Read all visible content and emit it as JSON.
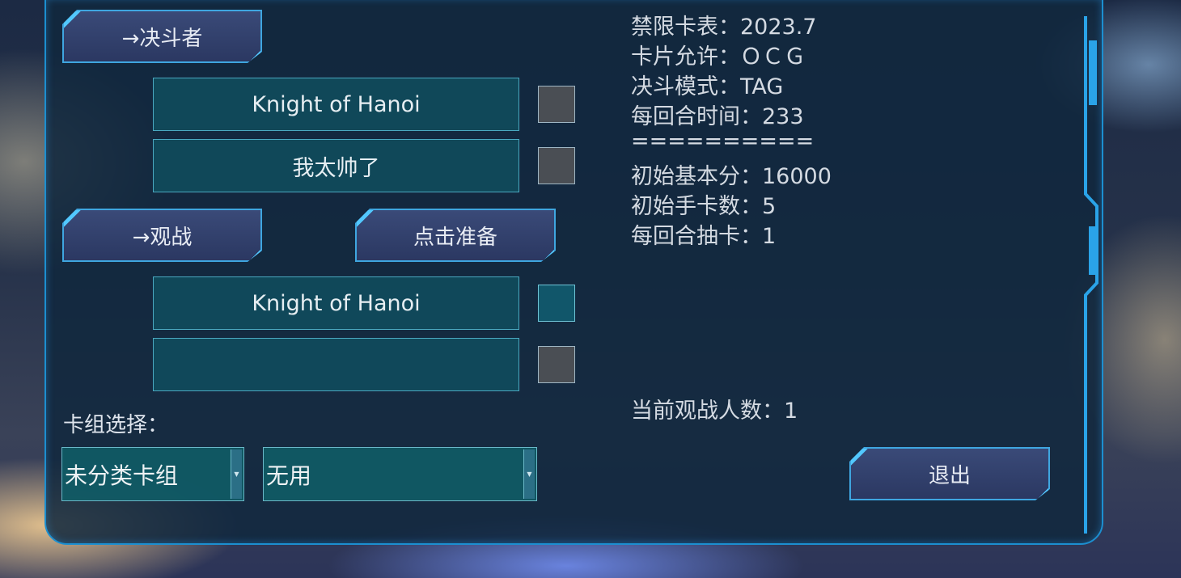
{
  "buttons": {
    "duelist": "→决斗者",
    "spectate": "→观战",
    "ready": "点击准备",
    "exit": "退出"
  },
  "players": [
    {
      "name": "Knight of Hanoi",
      "checked": false
    },
    {
      "name": "我太帅了",
      "checked": false
    },
    {
      "name": "Knight of Hanoi",
      "checked": true
    },
    {
      "name": "",
      "checked": false
    }
  ],
  "info": {
    "banlist": "禁限卡表：2023.7",
    "card_allowed": "卡片允许：ＯＣＧ",
    "duel_mode": "决斗模式：TAG",
    "turn_time": "每回合时间：233",
    "separator": "==========",
    "start_lp": "初始基本分：16000",
    "start_hand": "初始手卡数：5",
    "draw_per_turn": "每回合抽卡：1",
    "spectators": "当前观战人数：1"
  },
  "deck": {
    "label": "卡组选择：",
    "category": "未分类卡组",
    "deck_name": "无用"
  },
  "colors": {
    "accent": "#3fa6e0",
    "panel": "#10283e",
    "name_box": "#0f5564"
  }
}
